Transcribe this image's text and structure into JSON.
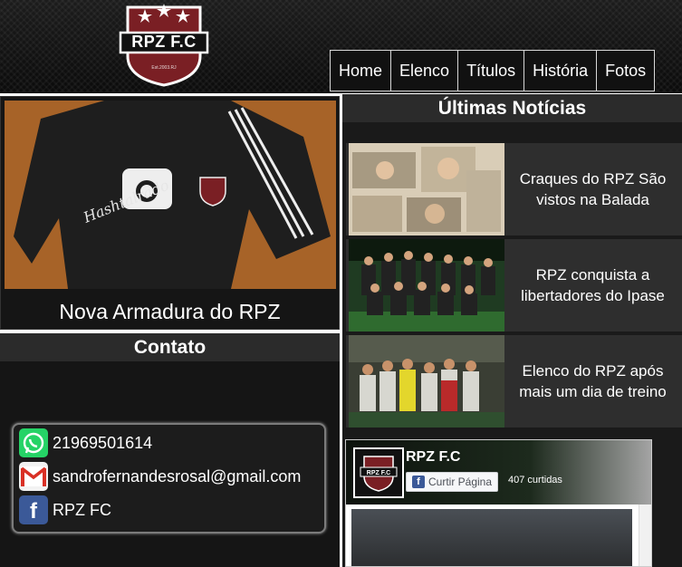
{
  "header": {
    "logo_text": "RPZ F.C",
    "logo_small": "Est.2003.RJ",
    "nav": [
      "Home",
      "Elenco",
      "Títulos",
      "História",
      "Fotos"
    ]
  },
  "feature": {
    "caption": "Nova Armadura do RPZ"
  },
  "contato": {
    "title": "Contato",
    "phone": "21969501614",
    "email": "sandrofernandesrosal@gmail.com",
    "facebook": "RPZ FC"
  },
  "news": {
    "title": "Últimas Notícias",
    "items": [
      "Craques do RPZ São vistos na Balada",
      "RPZ conquista a libertadores do Ipase",
      "Elenco do RPZ após mais um dia de treino"
    ]
  },
  "facebook_widget": {
    "page_name": "RPZ F.C",
    "like_label": "Curtir Página",
    "likes": "407 curtidas"
  },
  "colors": {
    "background": "#151515",
    "logo_red": "#7a1f24",
    "fb_blue": "#3b5998",
    "whatsapp": "#25d366"
  },
  "icons": [
    "whatsapp-icon",
    "gmail-icon",
    "facebook-icon"
  ]
}
